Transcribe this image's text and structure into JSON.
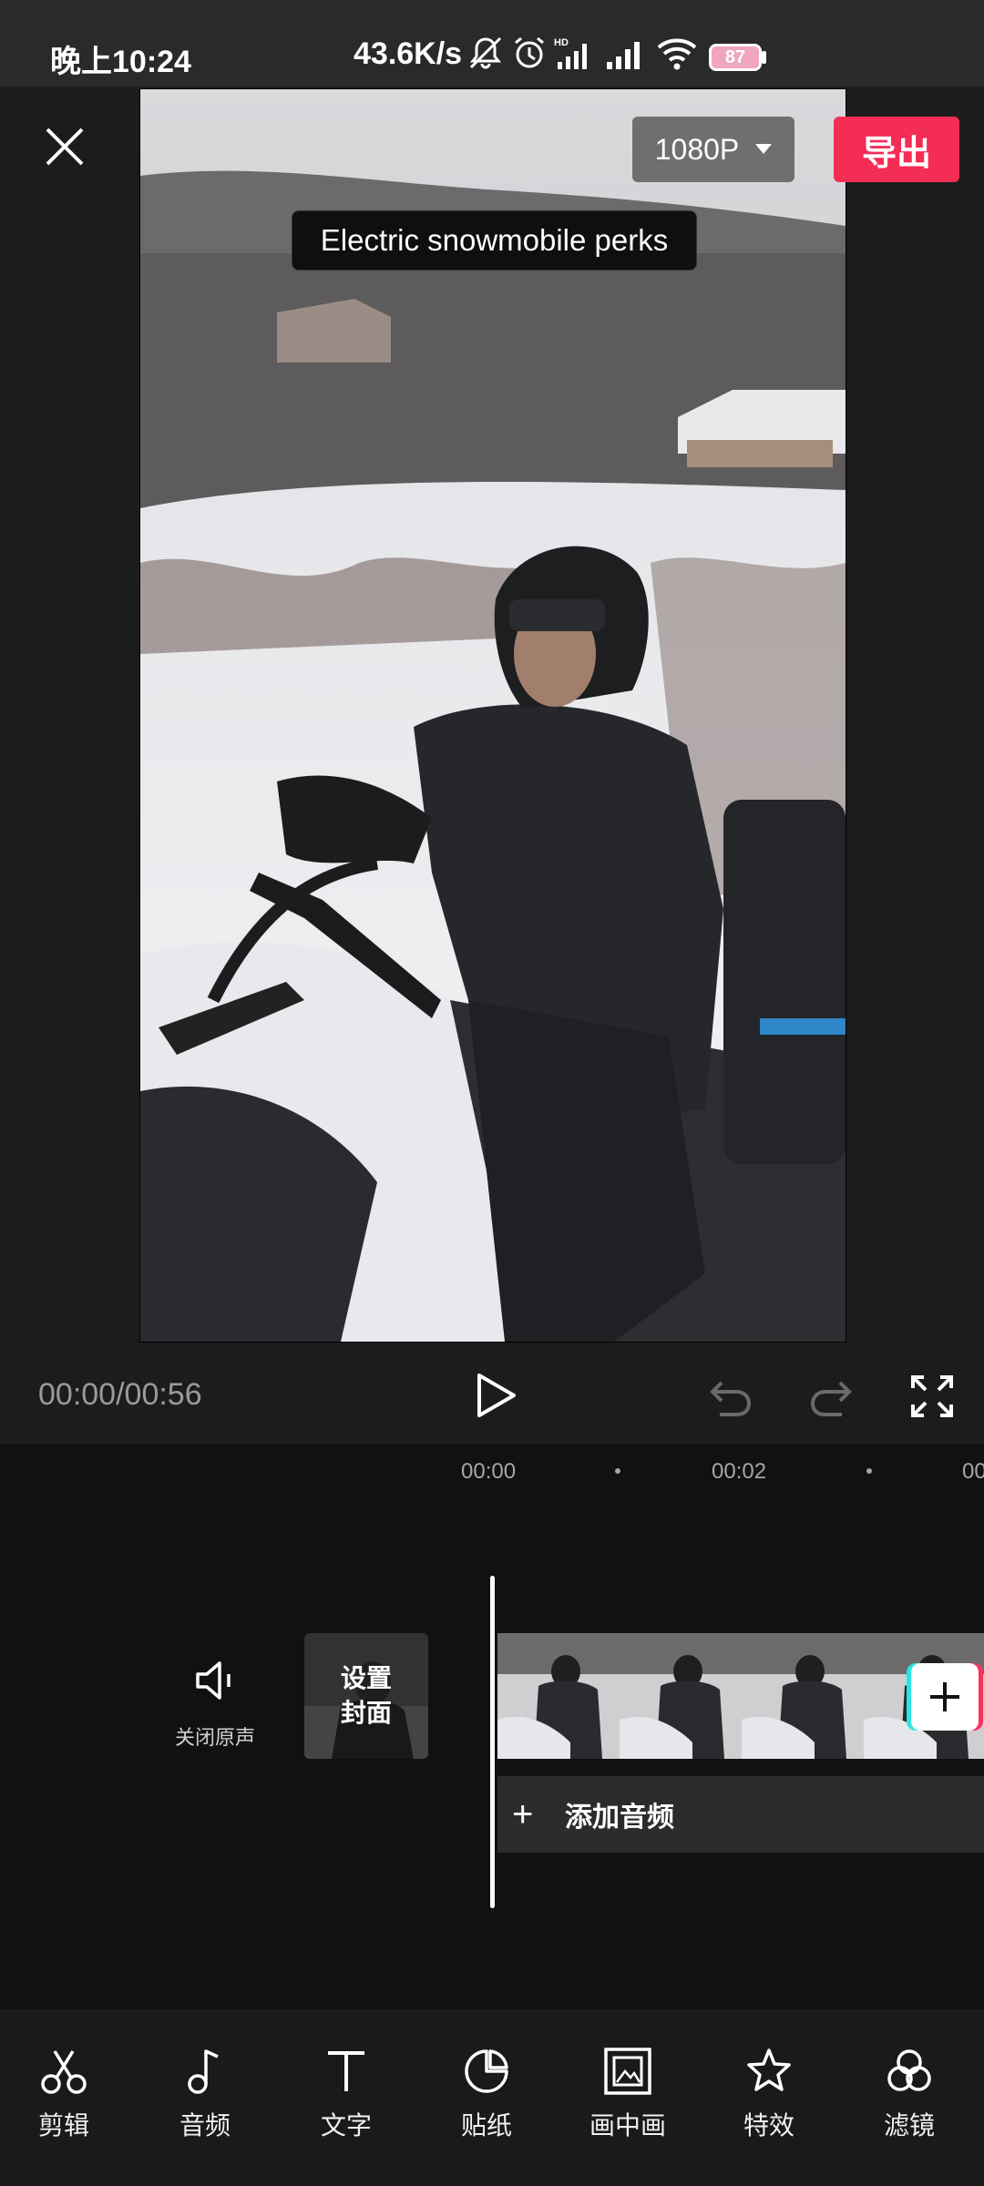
{
  "status_bar": {
    "time": "晚上10:24",
    "network_speed": "43.6K/s",
    "battery": "87",
    "icons": [
      "mute-bell-icon",
      "alarm-icon",
      "hd-signal-icon",
      "signal-icon",
      "wifi-icon",
      "battery-icon"
    ]
  },
  "header": {
    "resolution": "1080P",
    "export_label": "导出"
  },
  "preview": {
    "caption": "Electric snowmobile perks"
  },
  "playback": {
    "time": "00:00/00:56"
  },
  "timeline": {
    "ruler": [
      "00:00",
      "00:02",
      "00:0"
    ],
    "mute_label": "关闭原声",
    "cover_line1": "设置",
    "cover_line2": "封面",
    "add_audio_label": "添加音频"
  },
  "toolbar": {
    "items": [
      {
        "label": "剪辑",
        "icon": "scissors-icon"
      },
      {
        "label": "音频",
        "icon": "music-note-icon"
      },
      {
        "label": "文字",
        "icon": "text-icon"
      },
      {
        "label": "贴纸",
        "icon": "sticker-icon"
      },
      {
        "label": "画中画",
        "icon": "picture-in-picture-icon"
      },
      {
        "label": "特效",
        "icon": "effects-star-icon"
      },
      {
        "label": "滤镜",
        "icon": "filter-icon"
      }
    ]
  },
  "colors": {
    "accent": "#f42d55",
    "background": "#111111",
    "panel": "#1c1c1c"
  }
}
